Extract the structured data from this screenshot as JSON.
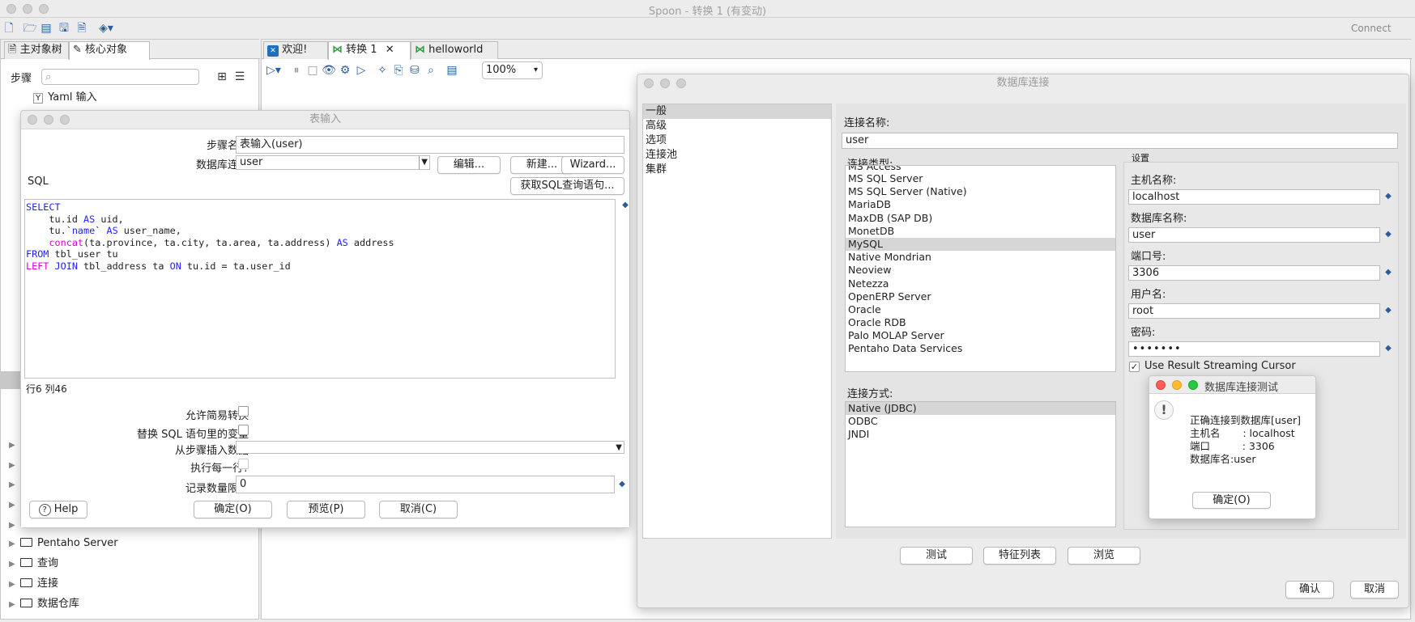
{
  "app": {
    "title": "Spoon - 转换 1 (有变动)",
    "connect": "Connect"
  },
  "left_tabs": [
    "主对象树",
    "核心对象"
  ],
  "steps_label": "步骤",
  "search_placeholder": "",
  "tree": {
    "top_item": "Yaml 输入",
    "folders": [
      "Pentaho Server",
      "查询",
      "连接",
      "数据仓库"
    ]
  },
  "editor_tabs": [
    "欢迎!",
    "转换 1",
    "helloworld"
  ],
  "zoom": "100%",
  "table_input": {
    "title": "表输入",
    "step_name_label": "步骤名称",
    "step_name_value": "表输入(user)",
    "db_conn_label": "数据库连接",
    "db_conn_value": "user",
    "edit_btn": "编辑...",
    "new_btn": "新建...",
    "wizard_btn": "Wizard...",
    "sql_label": "SQL",
    "get_sql_btn": "获取SQL查询语句...",
    "sql_lines": [
      "SELECT",
      "    tu.id AS uid,",
      "    tu.`name` AS user_name,",
      "    concat(ta.province, ta.city, ta.area, ta.address) AS address",
      "FROM tbl_user tu",
      "LEFT JOIN tbl_address ta ON tu.id = ta.user_id"
    ],
    "position": "行6 列46",
    "lazy_conv_label": "允许简易转换",
    "replace_vars_label": "替换 SQL 语句里的变量",
    "insert_from_step_label": "从步骤插入数据",
    "exec_each_row_label": "执行每一行?",
    "limit_label": "记录数量限制",
    "limit_value": "0",
    "help_btn": "Help",
    "ok_btn": "确定(O)",
    "preview_btn": "预览(P)",
    "cancel_btn": "取消(C)"
  },
  "db_dialog": {
    "title": "数据库连接",
    "nav": [
      "一般",
      "高级",
      "选项",
      "连接池",
      "集群"
    ],
    "conn_name_label": "连接名称:",
    "conn_name_value": "user",
    "conn_type_label": "连接类型:",
    "conn_types": [
      "MS Access",
      "MS SQL Server",
      "MS SQL Server (Native)",
      "MariaDB",
      "MaxDB (SAP DB)",
      "MonetDB",
      "MySQL",
      "Native Mondrian",
      "Neoview",
      "Netezza",
      "OpenERP Server",
      "Oracle",
      "Oracle RDB",
      "Palo MOLAP Server",
      "Pentaho Data Services"
    ],
    "conn_type_selected": "MySQL",
    "access_label": "连接方式:",
    "access_types": [
      "Native (JDBC)",
      "ODBC",
      "JNDI"
    ],
    "settings_label": "设置",
    "host_label": "主机名称:",
    "host_value": "localhost",
    "dbname_label": "数据库名称:",
    "dbname_value": "user",
    "port_label": "端口号:",
    "port_value": "3306",
    "user_label": "用户名:",
    "user_value": "root",
    "pwd_label": "密码:",
    "pwd_value": "•••••••",
    "streaming_label": "Use Result Streaming Cursor",
    "test_btn": "测试",
    "features_btn": "特征列表",
    "browse_btn": "浏览",
    "confirm_btn": "确认",
    "cancel_btn": "取消"
  },
  "test_dialog": {
    "title": "数据库连接测试",
    "line1": "正确连接到数据库[user]",
    "line2": "主机名       : localhost",
    "line3": "端口          : 3306",
    "line4": "数据库名:user",
    "ok_btn": "确定(O)"
  }
}
